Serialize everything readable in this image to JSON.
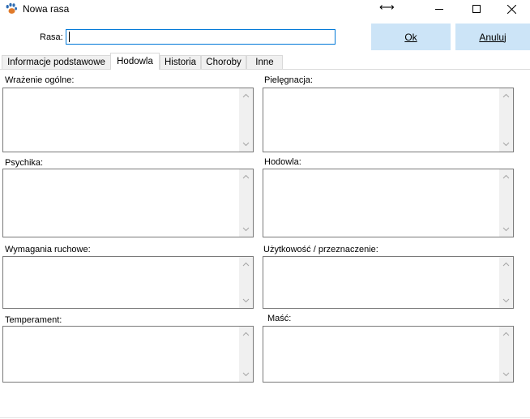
{
  "window": {
    "title": "Nowa rasa"
  },
  "form": {
    "rasa_label": "Rasa:",
    "rasa_value": "",
    "ok_button": "Ok",
    "cancel_button": "Anuluj"
  },
  "tabs": [
    {
      "label": "Informacje podstawowe",
      "active": false
    },
    {
      "label": "Hodowla",
      "active": true
    },
    {
      "label": "Historia",
      "active": false
    },
    {
      "label": "Choroby",
      "active": false
    },
    {
      "label": "Inne",
      "active": false
    }
  ],
  "fields": {
    "wrazenie": {
      "label": "Wrażenie ogólne:",
      "value": ""
    },
    "pielegnacja": {
      "label": "Pielęgnacja:",
      "value": ""
    },
    "psychika": {
      "label": "Psychika:",
      "value": ""
    },
    "hodowla": {
      "label": "Hodowla:",
      "value": ""
    },
    "wymagania": {
      "label": "Wymagania ruchowe:",
      "value": ""
    },
    "uzytkowosc": {
      "label": "Użytkowość / przeznaczenie:",
      "value": ""
    },
    "temperament": {
      "label": "Temperament:",
      "value": ""
    },
    "masc": {
      "label": "Maść:",
      "value": ""
    }
  },
  "colors": {
    "button_bg": "#cce4f7",
    "input_focus_border": "#0078d7",
    "tab_bg": "#f0f0f0",
    "scrollbar_bg": "#f0f0f0"
  },
  "icons": {
    "app": "paw-icon",
    "resize": "resize-horizontal-icon",
    "minimize": "minimize-icon",
    "maximize": "maximize-icon",
    "close": "close-icon",
    "scroll_up": "chevron-up-icon",
    "scroll_down": "chevron-down-icon"
  }
}
